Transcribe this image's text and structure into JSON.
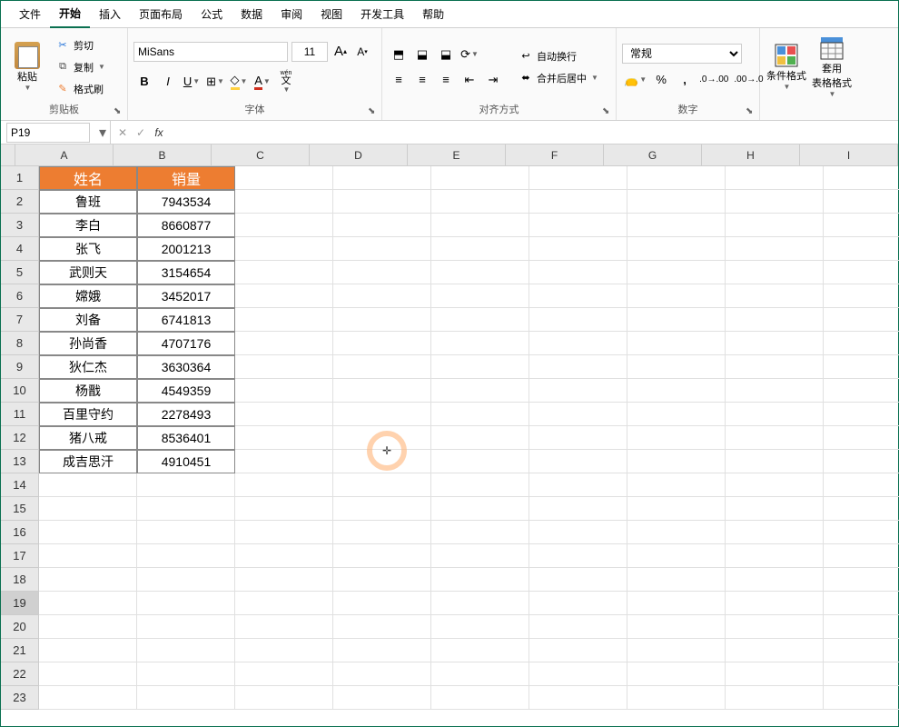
{
  "menu": {
    "items": [
      "文件",
      "开始",
      "插入",
      "页面布局",
      "公式",
      "数据",
      "审阅",
      "视图",
      "开发工具",
      "帮助"
    ],
    "active_index": 1
  },
  "ribbon": {
    "clipboard": {
      "paste": "粘贴",
      "cut": "剪切",
      "copy": "复制",
      "format_painter": "格式刷",
      "label": "剪贴板"
    },
    "font": {
      "name": "MiSans",
      "size": "11",
      "wen": "wén",
      "wen2": "文",
      "label": "字体"
    },
    "align": {
      "wrap": "自动换行",
      "merge": "合并后居中",
      "label": "对齐方式"
    },
    "number": {
      "format": "常规",
      "label": "数字"
    },
    "styles": {
      "cond_format": "条件格式",
      "table_format": "套用\n表格格式"
    }
  },
  "formula_bar": {
    "cell_ref": "P19",
    "fx": "fx",
    "value": ""
  },
  "grid": {
    "columns": [
      "A",
      "B",
      "C",
      "D",
      "E",
      "F",
      "G",
      "H",
      "I"
    ],
    "row_count": 23,
    "selected_row": 19,
    "headers": [
      "姓名",
      "销量"
    ],
    "data": [
      {
        "name": "鲁班",
        "sales": "7943534"
      },
      {
        "name": "李白",
        "sales": "8660877"
      },
      {
        "name": "张飞",
        "sales": "2001213"
      },
      {
        "name": "武则天",
        "sales": "3154654"
      },
      {
        "name": "嫦娥",
        "sales": "3452017"
      },
      {
        "name": "刘备",
        "sales": "6741813"
      },
      {
        "name": "孙尚香",
        "sales": "4707176"
      },
      {
        "name": "狄仁杰",
        "sales": "3630364"
      },
      {
        "name": "杨戬",
        "sales": "4549359"
      },
      {
        "name": "百里守约",
        "sales": "2278493"
      },
      {
        "name": "猪八戒",
        "sales": "8536401"
      },
      {
        "name": "成吉思汗",
        "sales": "4910451"
      }
    ]
  },
  "chart_data": {
    "type": "table",
    "title": "",
    "columns": [
      "姓名",
      "销量"
    ],
    "rows": [
      [
        "鲁班",
        7943534
      ],
      [
        "李白",
        8660877
      ],
      [
        "张飞",
        2001213
      ],
      [
        "武则天",
        3154654
      ],
      [
        "嫦娥",
        3452017
      ],
      [
        "刘备",
        6741813
      ],
      [
        "孙尚香",
        4707176
      ],
      [
        "狄仁杰",
        3630364
      ],
      [
        "杨戬",
        4549359
      ],
      [
        "百里守约",
        2278493
      ],
      [
        "猪八戒",
        8536401
      ],
      [
        "成吉思汗",
        4910451
      ]
    ]
  }
}
